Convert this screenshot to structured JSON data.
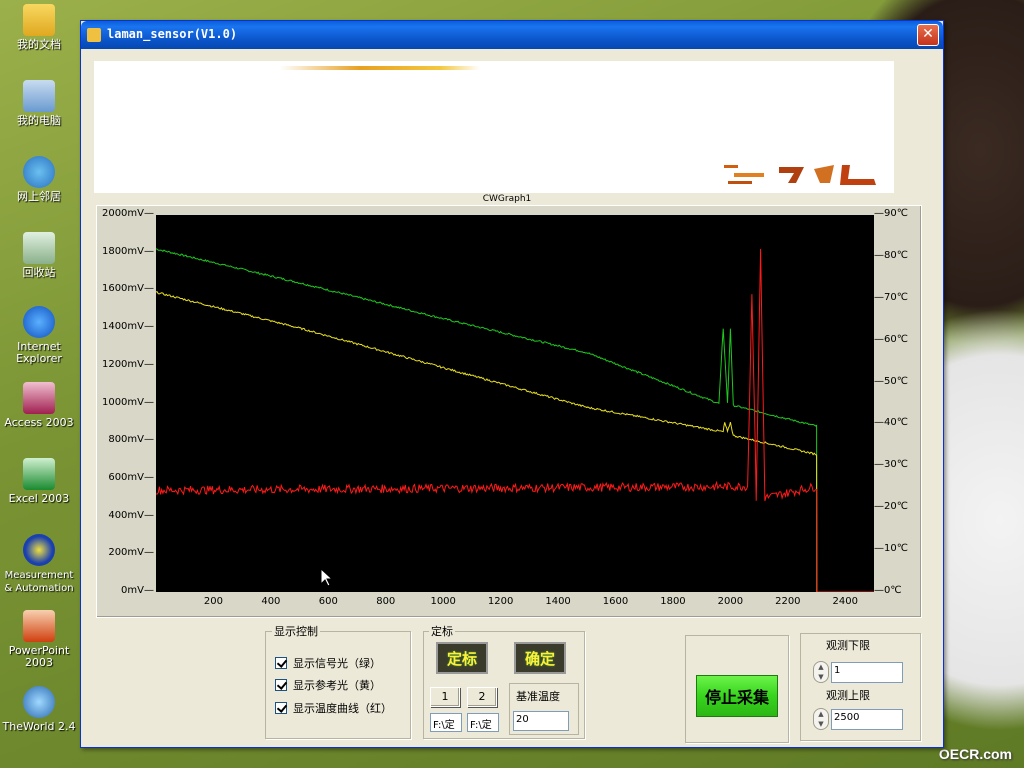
{
  "desktop": {
    "icons": [
      {
        "label": "我的文档",
        "name": "my-documents"
      },
      {
        "label": "我的电脑",
        "name": "my-computer"
      },
      {
        "label": "网上邻居",
        "name": "network-places"
      },
      {
        "label": "回收站",
        "name": "recycle-bin"
      },
      {
        "label": "Internet\nExplorer",
        "name": "internet-explorer"
      },
      {
        "label": "Access 2003",
        "name": "access-2003"
      },
      {
        "label": "Excel 2003",
        "name": "excel-2003"
      },
      {
        "label": "Measurement\n& Automation",
        "name": "measurement-automation"
      },
      {
        "label": "PowerPoint\n2003",
        "name": "powerpoint-2003"
      },
      {
        "label": "TheWorld 2.4",
        "name": "theworld"
      }
    ],
    "watermark": "OECR.com"
  },
  "window": {
    "title": "laman_sensor(V1.0)",
    "close_label": "✕"
  },
  "graph": {
    "caption": "CWGraph1"
  },
  "chart_data": {
    "type": "line",
    "title": "",
    "xlabel": "",
    "ylabel": "",
    "xlim": [
      0,
      2500
    ],
    "ylim": [
      0,
      2000
    ],
    "y2lim": [
      0,
      90
    ],
    "x_ticks": [
      200,
      400,
      600,
      800,
      1000,
      1200,
      1400,
      1600,
      1800,
      2000,
      2200,
      2400
    ],
    "y_ticks_left": [
      "0mV",
      "200mV",
      "400mV",
      "600mV",
      "800mV",
      "1000mV",
      "1200mV",
      "1400mV",
      "1600mV",
      "1800mV",
      "2000mV"
    ],
    "y_ticks_right": [
      "0℃",
      "10℃",
      "20℃",
      "30℃",
      "40℃",
      "50℃",
      "60℃",
      "70℃",
      "80℃",
      "90℃"
    ],
    "background": "#000000",
    "series": [
      {
        "color": "#1ec81e",
        "x": [
          0,
          500,
          1000,
          1500,
          1960,
          1975,
          1990,
          2000,
          2010,
          2300,
          2301,
          2500
        ],
        "values": [
          1820,
          1640,
          1450,
          1270,
          1000,
          1400,
          1000,
          1400,
          990,
          880,
          0,
          0
        ]
      },
      {
        "color": "#e8e020",
        "x": [
          0,
          500,
          1000,
          1500,
          1975,
          1980,
          1990,
          2000,
          2010,
          2300,
          2301,
          2500
        ],
        "values": [
          1590,
          1400,
          1190,
          980,
          850,
          900,
          850,
          900,
          830,
          730,
          0,
          0
        ]
      },
      {
        "color": "#ff1a1a",
        "x": [
          0,
          2060,
          2075,
          2090,
          2105,
          2120,
          2300,
          2301,
          2500
        ],
        "values": [
          540,
          560,
          1600,
          500,
          1820,
          500,
          560,
          0,
          0
        ]
      }
    ]
  },
  "display_control": {
    "title": "显示控制",
    "items": [
      {
        "label": "显示信号光（绿）",
        "checked": true
      },
      {
        "label": "显示参考光（黄）",
        "checked": true
      },
      {
        "label": "显示温度曲线（红）",
        "checked": true
      }
    ]
  },
  "calibration": {
    "title": "定标",
    "calibrate_label": "定标",
    "confirm_label": "确定",
    "btn1_label": "1",
    "btn2_label": "2",
    "path1_value": "F:\\定",
    "path2_value": "F:\\定",
    "base_temp_label": "基准温度",
    "base_temp_value": "20"
  },
  "acquisition": {
    "stop_label": "停止采集"
  },
  "observation": {
    "lower_label": "观测下限",
    "lower_value": "1",
    "upper_label": "观测上限",
    "upper_value": "2500"
  }
}
